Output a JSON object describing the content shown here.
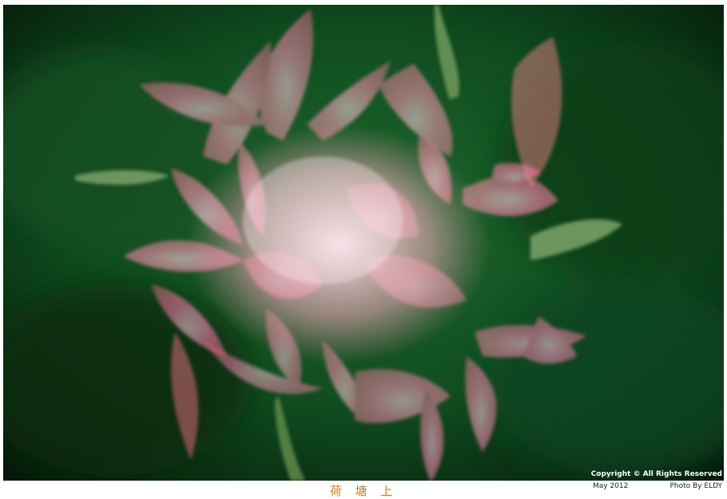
{
  "photo": {
    "subject": "pink lotus flower, multiple exposure, against dark green leaves"
  },
  "caption": {
    "title": "荷 塘 上"
  },
  "watermark": {
    "copyright": "Copyright © All Rights Reserved",
    "date": "May 2012",
    "credit": "Photo By ELDY"
  },
  "colors": {
    "background_leaf": "#0b3a18",
    "petal_pink": "#ff5aa8",
    "caption": "#e07a2a"
  }
}
